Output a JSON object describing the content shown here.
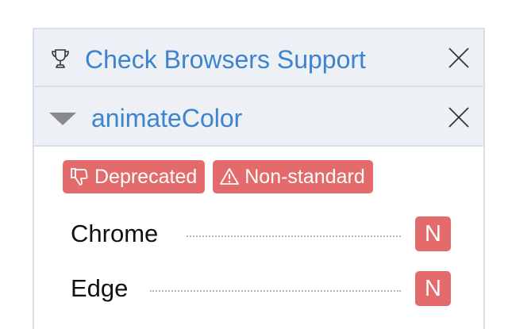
{
  "header": {
    "title": "Check Browsers Support",
    "icon": "trophy-icon"
  },
  "feature": {
    "name": "animateColor",
    "expanded": true
  },
  "badges": [
    {
      "label": "Deprecated",
      "icon": "thumbs-down-icon"
    },
    {
      "label": "Non-standard",
      "icon": "warning-icon"
    }
  ],
  "browsers": [
    {
      "name": "Chrome",
      "support": "N"
    },
    {
      "name": "Edge",
      "support": "N"
    }
  ],
  "colors": {
    "accent": "#3d83ce",
    "badge": "#e46b6b",
    "header_bg": "#edf1f6",
    "border": "#d7dfe8"
  }
}
